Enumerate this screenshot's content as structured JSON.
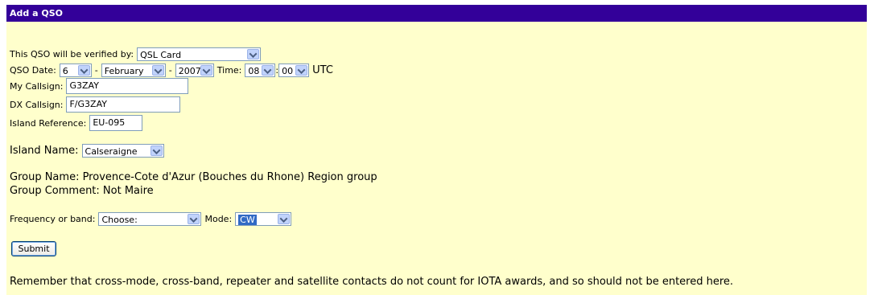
{
  "header": {
    "title": "Add a QSO"
  },
  "verified": {
    "label": "This QSO will be verified by:",
    "value": "QSL Card"
  },
  "date": {
    "label": "QSO Date:",
    "day": "6",
    "sep1": "-",
    "month": "February",
    "sep2": "-",
    "year": "2007",
    "time_label": "Time:",
    "hour": "08",
    "colon": ":",
    "minute": "00",
    "tz": "UTC"
  },
  "my_callsign": {
    "label": "My Callsign:",
    "value": "G3ZAY"
  },
  "dx_callsign": {
    "label": "DX Callsign:",
    "value": "F/G3ZAY"
  },
  "island_ref": {
    "label": "Island Reference:",
    "value": "EU-095"
  },
  "island_name": {
    "label": "Island Name:",
    "value": "Calseraigne"
  },
  "group": {
    "name_line": "Group Name: Provence-Cote d'Azur (Bouches du Rhone) Region group",
    "comment_line": "Group Comment: Not Maire"
  },
  "frequency": {
    "label": "Frequency or band:",
    "value": "Choose:"
  },
  "mode": {
    "label": "Mode:",
    "value": "CW"
  },
  "submit_label": "Submit",
  "note": "Remember that cross-mode, cross-band, repeater and satellite contacts do not count for IOTA awards, and so should not be entered here.",
  "colors": {
    "header_bg": "#330099",
    "panel_bg": "#ffffcc",
    "selection": "#316ac5"
  }
}
